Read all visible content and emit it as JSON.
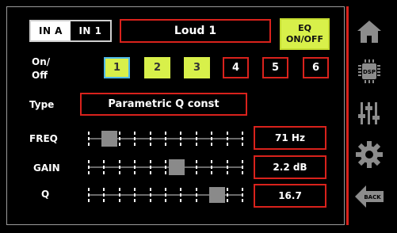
{
  "input": {
    "tabs": [
      "IN A",
      "IN 1"
    ]
  },
  "preset_name": "Loud 1",
  "eq_button": {
    "line1": "EQ",
    "line2": "ON/OFF"
  },
  "labels": {
    "onoff_line1": "On/",
    "onoff_line2": "Off",
    "type": "Type",
    "freq": "FREQ",
    "gain": "GAIN",
    "q": "Q"
  },
  "channels": [
    {
      "label": "1",
      "active": true,
      "selected": true
    },
    {
      "label": "2",
      "active": true,
      "selected": false
    },
    {
      "label": "3",
      "active": true,
      "selected": false
    },
    {
      "label": "4",
      "active": false,
      "selected": false
    },
    {
      "label": "5",
      "active": false,
      "selected": false
    },
    {
      "label": "6",
      "active": false,
      "selected": false
    }
  ],
  "filter_type": "Parametric Q const",
  "freq": {
    "value": "71 Hz",
    "level": 0.14
  },
  "gain": {
    "value": "2.2 dB",
    "level": 0.57
  },
  "q": {
    "value": "16.7",
    "level": 0.83
  },
  "sidebar": {
    "icons": [
      "home-icon",
      "dsp-chip-icon",
      "mixer-sliders-icon",
      "gear-icon",
      "back-arrow-icon"
    ],
    "dsp_label": "DSP",
    "back_label": "BACK"
  },
  "colors": {
    "accent_red": "#d9221c",
    "active_green": "#d8f04a",
    "selected_blue": "#4fb8e8"
  }
}
